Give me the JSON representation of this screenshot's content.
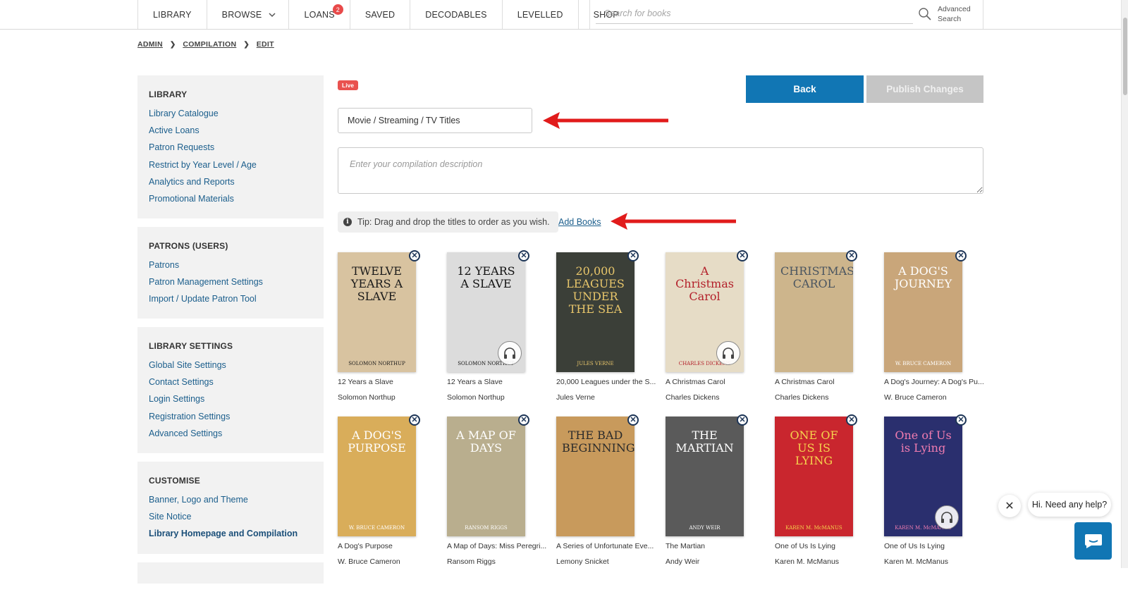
{
  "nav": {
    "items": [
      {
        "label": "LIBRARY"
      },
      {
        "label": "BROWSE"
      },
      {
        "label": "LOANS",
        "badge": "2"
      },
      {
        "label": "SAVED"
      },
      {
        "label": "DECODABLES"
      },
      {
        "label": "LEVELLED"
      },
      {
        "label": "SHOP"
      }
    ],
    "search_placeholder": "Search for books",
    "advanced_search_line1": "Advanced",
    "advanced_search_line2": "Search"
  },
  "breadcrumb": [
    "ADMIN",
    "COMPILATION",
    "EDIT"
  ],
  "sidebar": {
    "library": {
      "heading": "LIBRARY",
      "links": [
        "Library Catalogue",
        "Active Loans",
        "Patron Requests",
        "Restrict by Year Level / Age",
        "Analytics and Reports",
        "Promotional Materials"
      ]
    },
    "patrons": {
      "heading": "PATRONS (USERS)",
      "links": [
        "Patrons",
        "Patron Management Settings",
        "Import / Update Patron Tool"
      ]
    },
    "settings": {
      "heading": "LIBRARY SETTINGS",
      "links": [
        "Global Site Settings",
        "Contact Settings",
        "Login Settings",
        "Registration Settings",
        "Advanced Settings"
      ]
    },
    "customise": {
      "heading": "CUSTOMISE",
      "links": [
        "Banner, Logo and Theme",
        "Site Notice",
        "Library Homepage and Compilation"
      ]
    }
  },
  "editor": {
    "status_badge": "Live",
    "back_label": "Back",
    "publish_label": "Publish Changes",
    "title_value": "Movie / Streaming / TV Titles",
    "description_placeholder": "Enter your compilation description",
    "tip_text": "Tip: Drag and drop the titles to order as you wish.",
    "add_books_label": "Add Books"
  },
  "books": [
    {
      "title": "12 Years a Slave",
      "author": "Solomon Northup",
      "cover_text": "TWELVE YEARS A SLAVE",
      "cover_sub": "SOLOMON NORTHUP",
      "bg": "#d8c3a0",
      "fg": "#1a1a1a",
      "audio": false
    },
    {
      "title": "12 Years a Slave",
      "author": "Solomon Northup",
      "cover_text": "12 YEARS A SLAVE",
      "cover_sub": "SOLOMON NORTHUP",
      "bg": "#dcdcdc",
      "fg": "#111111",
      "audio": true
    },
    {
      "title": "20,000 Leagues under the S...",
      "author": "Jules Verne",
      "cover_text": "20,000 LEAGUES UNDER THE SEA",
      "cover_sub": "JULES VERNE",
      "bg": "#3b3f38",
      "fg": "#e8c66b",
      "audio": false
    },
    {
      "title": "A Christmas Carol",
      "author": "Charles Dickens",
      "cover_text": "A Christmas Carol",
      "cover_sub": "CHARLES DICKENS",
      "bg": "#e6dcc6",
      "fg": "#b3202a",
      "audio": true
    },
    {
      "title": "A Christmas Carol",
      "author": "Charles Dickens",
      "cover_text": "CHRISTMAS CAROL",
      "cover_sub": "",
      "bg": "#cdb58c",
      "fg": "#4a5560",
      "audio": false
    },
    {
      "title": "A Dog's Journey: A Dog's Pu...",
      "author": "W. Bruce Cameron",
      "cover_text": "A DOG'S JOURNEY",
      "cover_sub": "W. BRUCE CAMERON",
      "bg": "#c9a67a",
      "fg": "#ffffff",
      "audio": false
    },
    {
      "title": "A Dog's Purpose",
      "author": "W. Bruce Cameron",
      "cover_text": "A DOG'S PURPOSE",
      "cover_sub": "W. BRUCE CAMERON",
      "bg": "#d9ad5a",
      "fg": "#ffffff",
      "audio": false
    },
    {
      "title": "A Map of Days: Miss Peregri...",
      "author": "Ransom Riggs",
      "cover_text": "A MAP OF DAYS",
      "cover_sub": "RANSOM RIGGS",
      "bg": "#b9ae8e",
      "fg": "#ffffff",
      "audio": false
    },
    {
      "title": "A Series of Unfortunate Eve...",
      "author": "Lemony Snicket",
      "cover_text": "THE BAD BEGINNING",
      "cover_sub": "",
      "bg": "#c89a5c",
      "fg": "#2b2b2b",
      "audio": false
    },
    {
      "title": "The Martian",
      "author": "Andy Weir",
      "cover_text": "THE MARTIAN",
      "cover_sub": "ANDY WEIR",
      "bg": "#5a5a5a",
      "fg": "#ffffff",
      "audio": false
    },
    {
      "title": "One of Us Is Lying",
      "author": "Karen M. McManus",
      "cover_text": "ONE OF US IS LYING",
      "cover_sub": "KAREN M. McMANUS",
      "bg": "#c9262e",
      "fg": "#f5d34d",
      "audio": false
    },
    {
      "title": "One of Us Is Lying",
      "author": "Karen M. McManus",
      "cover_text": "One of Us is Lying",
      "cover_sub": "KAREN M. McMANUS",
      "bg": "#2a2f6e",
      "fg": "#f07cb0",
      "audio": true
    }
  ],
  "help": {
    "bubble_text": "Hi. Need any help?"
  }
}
